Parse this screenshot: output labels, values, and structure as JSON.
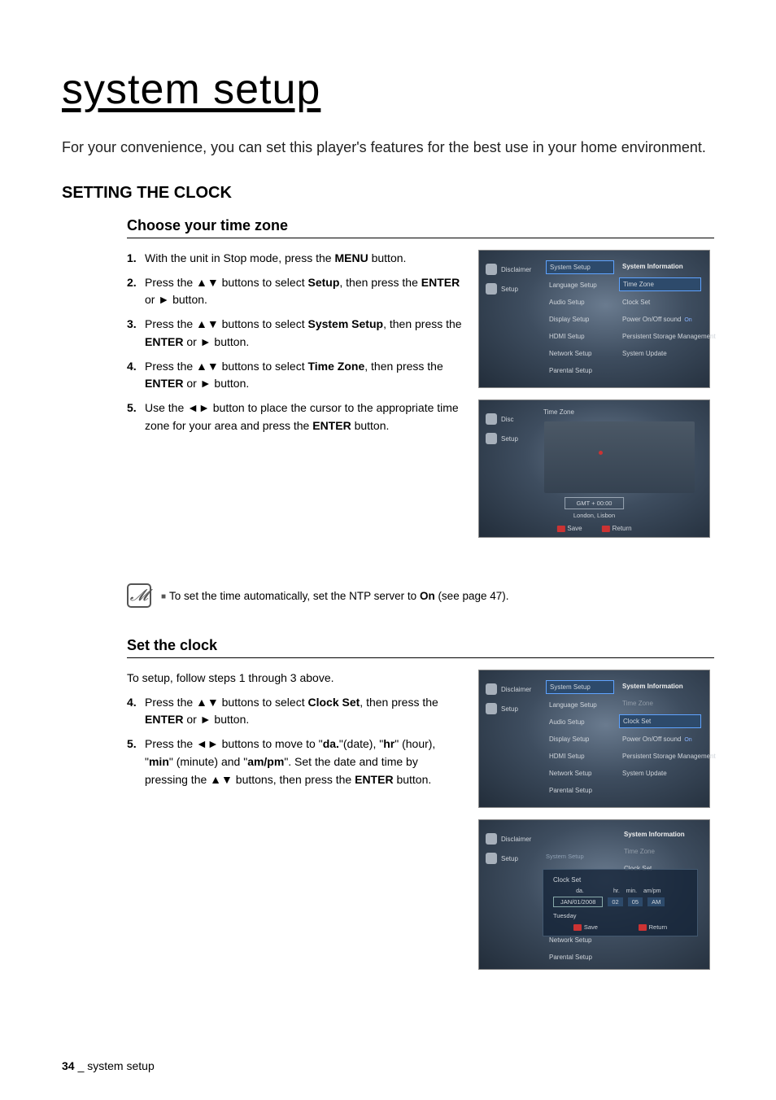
{
  "page": {
    "title": "system setup",
    "intro": "For your convenience, you can set this player's features for the best use in your home environment.",
    "section_heading": "SETTING THE CLOCK",
    "footer_page": "34",
    "footer_label": "_ system setup"
  },
  "timezone": {
    "heading": "Choose your time zone",
    "steps": [
      {
        "n": "1.",
        "pre": "With the unit in Stop mode, press the ",
        "b1": "MENU",
        "post": " button."
      },
      {
        "n": "2.",
        "pre": "Press the ",
        "arrows": "▲▼",
        "mid": " buttons to select ",
        "b1": "Setup",
        "mid2": ", then press the ",
        "b2": "ENTER",
        "or": " or ",
        "play": "►",
        "post": " button."
      },
      {
        "n": "3.",
        "pre": "Press the ",
        "arrows": "▲▼",
        "mid": " buttons to select ",
        "b1": "System Setup",
        "mid2": ", then press the ",
        "b2": "ENTER",
        "or": " or ",
        "play": "►",
        "post": " button."
      },
      {
        "n": "4.",
        "pre": "Press the ",
        "arrows": "▲▼",
        "mid": " buttons to select ",
        "b1": "Time Zone",
        "mid2": ", then press the ",
        "b2": "ENTER",
        "or": " or ",
        "play": "►",
        "post": " button."
      },
      {
        "n": "5.",
        "pre": "Use the ",
        "arrows": "◄►",
        "mid": " button to place the cursor to the appropriate time zone for your area and press the ",
        "b1": "ENTER",
        "post": " button."
      }
    ]
  },
  "note": {
    "text_pre": "To set the time automatically, set the NTP server to ",
    "text_bold": "On",
    "text_post": " (see page 47)."
  },
  "setclock": {
    "heading": "Set the clock",
    "lead": "To setup, follow steps 1 through 3 above.",
    "steps": [
      {
        "n": "4.",
        "pre": "Press the ",
        "arrows": "▲▼",
        "mid": " buttons to select ",
        "b1": "Clock Set",
        "mid2": ", then press the ",
        "b2": "ENTER",
        "or": " or ",
        "play": "►",
        "post": " button."
      },
      {
        "n": "5.",
        "pre": "Press the ",
        "arrows": "◄►",
        "mid": " buttons to move to \"",
        "b1": "da.",
        "mid2": "\"(date), \"",
        "b2": "hr",
        "mid3": "\" (hour), \"",
        "b3": "min",
        "mid4": "\" (minute) and \"",
        "b4": "am/pm",
        "mid5": "\". Set the date and time by pressing the ",
        "arrows2": "▲▼",
        "mid6": " buttons, then press the ",
        "b5": "ENTER",
        "post": " button."
      }
    ]
  },
  "osd": {
    "sidebar_disclaimer": "Disclaimer",
    "sidebar_setup": "Setup",
    "sidebar_disc": "Disc",
    "menu": {
      "system_setup": "System Setup",
      "language_setup": "Language Setup",
      "audio_setup": "Audio Setup",
      "display_setup": "Display Setup",
      "hdmi_setup": "HDMI Setup",
      "network_setup": "Network Setup",
      "parental_setup": "Parental Setup"
    },
    "right": {
      "system_information": "System Information",
      "time_zone": "Time Zone",
      "clock_set": "Clock Set",
      "power_onoff": "Power On/Off sound",
      "on": "On",
      "persistent": "Persistent Storage Management",
      "system_update": "System Update"
    },
    "map": {
      "header": "Time Zone",
      "gmt": "GMT + 00:00",
      "city": "London, Lisbon",
      "save": "Save",
      "return": "Return"
    },
    "clockset": {
      "panel_title": "Clock Set",
      "labels": {
        "da": "da.",
        "hr": "hr.",
        "min": "min.",
        "ampm": "am/pm"
      },
      "date": "JAN/01/2008",
      "hr": "02",
      "min": "05",
      "ampm": "AM",
      "day": "Tuesday",
      "save": "Save",
      "return": "Return"
    }
  }
}
